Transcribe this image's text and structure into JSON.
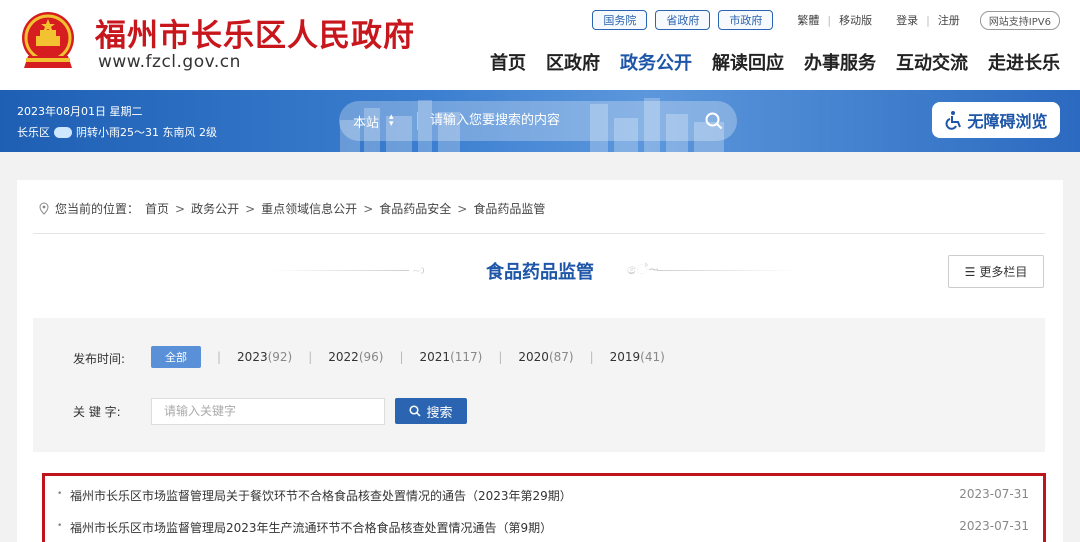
{
  "header": {
    "title": "福州市长乐区人民政府",
    "url": "www.fzcl.gov.cn",
    "gov_links": [
      "国务院",
      "省政府",
      "市政府"
    ],
    "util_links": [
      "繁體",
      "移动版",
      "登录",
      "注册"
    ],
    "ipv6": "网站支持IPV6",
    "nav": [
      "首页",
      "区政府",
      "政务公开",
      "解读回应",
      "办事服务",
      "互动交流",
      "走进长乐"
    ],
    "active_nav": "政务公开"
  },
  "banner": {
    "date": "2023年08月01日 星期二",
    "location": "长乐区",
    "weather": "阴转小雨25～31 东南风 2级",
    "scope": "本站",
    "search_placeholder": "请输入您要搜索的内容",
    "accessibility": "无障碍浏览"
  },
  "breadcrumb": {
    "prefix": "您当前的位置：",
    "items": [
      "首页",
      "政务公开",
      "重点领域信息公开",
      "食品药品安全",
      "食品药品监管"
    ]
  },
  "section": {
    "title": "食品药品监管",
    "more": "更多栏目"
  },
  "filter": {
    "time_label": "发布时间:",
    "all": "全部",
    "years": [
      {
        "year": "2023",
        "count": "(92)"
      },
      {
        "year": "2022",
        "count": "(96)"
      },
      {
        "year": "2021",
        "count": "(117)"
      },
      {
        "year": "2020",
        "count": "(87)"
      },
      {
        "year": "2019",
        "count": "(41)"
      }
    ],
    "keyword_label": "关 键 字:",
    "keyword_placeholder": "请输入关键字",
    "search_button": "搜索"
  },
  "articles": [
    {
      "title": "福州市长乐区市场监督管理局关于餐饮环节不合格食品核查处置情况的通告（2023年第29期）",
      "date": "2023-07-31"
    },
    {
      "title": "福州市长乐区市场监督管理局2023年生产流通环节不合格食品核查处置情况通告（第9期）",
      "date": "2023-07-31"
    }
  ]
}
